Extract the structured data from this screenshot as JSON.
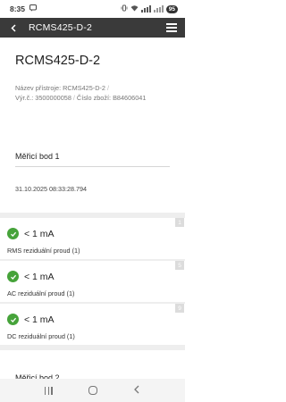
{
  "status_bar": {
    "time": "8:35",
    "notification_icon": "chat-icon",
    "battery": "95"
  },
  "app_bar": {
    "title": "RCMS425-D-2"
  },
  "device": {
    "title": "RCMS425-D-2",
    "name_line": "Název přístroje: RCMS425-D-2",
    "serial_line": "Výr.č.: 3500000058",
    "part_line": "Číslo zboží: B84606041"
  },
  "measurement_point": {
    "title": "Měřicí bod 1",
    "timestamp": "31.10.2025 08:33:28.794"
  },
  "results": [
    {
      "index": "1",
      "value": "< 1 mA",
      "label": "RMS reziduální proud (1)",
      "status": "ok"
    },
    {
      "index": "5",
      "value": "< 1 mA",
      "label": "AC reziduální proud (1)",
      "status": "ok"
    },
    {
      "index": "9",
      "value": "< 1 mA",
      "label": "DC reziduální proud (1)",
      "status": "ok"
    }
  ],
  "next_section_title": "Měřicí bod 2",
  "colors": {
    "app_bar": "#3a3a3a",
    "ok_green": "#46a33a"
  }
}
